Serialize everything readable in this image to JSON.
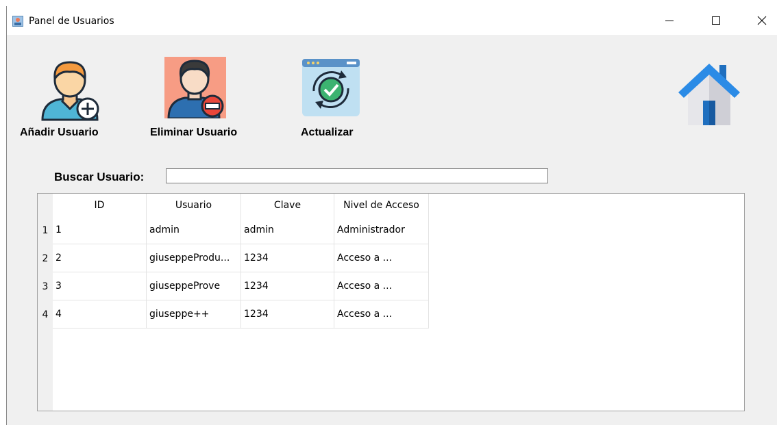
{
  "window": {
    "title": "Panel de Usuarios"
  },
  "toolbar": {
    "add_user_label": "Añadir Usuario",
    "delete_user_label": "Eliminar Usuario",
    "refresh_label": "Actualizar"
  },
  "search": {
    "label": "Buscar Usuario:",
    "value": ""
  },
  "table": {
    "columns": [
      "ID",
      "Usuario",
      "Clave",
      "Nivel de Acceso"
    ],
    "row_numbers": [
      "1",
      "2",
      "3",
      "4"
    ],
    "rows": [
      [
        "1",
        "admin",
        "admin",
        "Administrador"
      ],
      [
        "2",
        "giuseppeProdu...",
        "1234",
        "Acceso a ..."
      ],
      [
        "3",
        "giuseppeProve",
        "1234",
        "Acceso a ..."
      ],
      [
        "4",
        "giuseppe++",
        "1234",
        "Acceso a ..."
      ]
    ]
  },
  "icons": {
    "add_user": "user-add-icon",
    "delete_user": "user-remove-icon",
    "refresh": "refresh-check-icon",
    "home": "home-icon"
  },
  "colors": {
    "accent_blue": "#2b7fd8",
    "check_green": "#3cb371",
    "delete_bg": "#f79c84",
    "delete_badge": "#e8463a"
  }
}
